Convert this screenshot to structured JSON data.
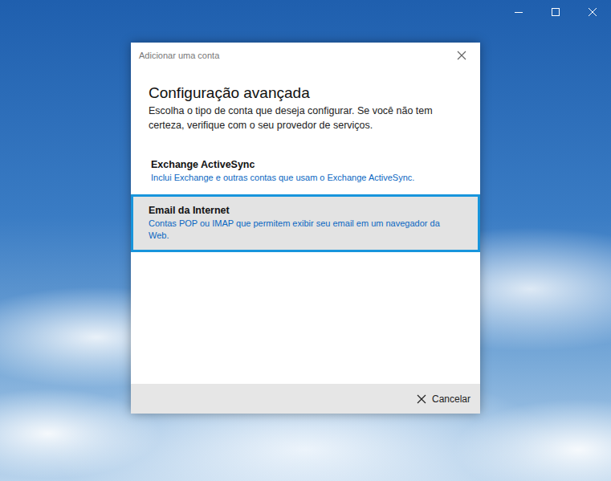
{
  "dialog": {
    "title": "Adicionar uma conta"
  },
  "heading": "Configuração avançada",
  "description": "Escolha o tipo de conta que deseja configurar. Se você não tem certeza, verifique com o seu provedor de serviços.",
  "options": [
    {
      "title": "Exchange ActiveSync",
      "description": "Inclui Exchange e outras contas que usam o Exchange ActiveSync.",
      "selected": false
    },
    {
      "title": "Email da Internet",
      "description": "Contas POP ou IMAP que permitem exibir seu email em um navegador da Web.",
      "selected": true
    }
  ],
  "buttons": [
    {
      "label": "Cancelar"
    }
  ]
}
